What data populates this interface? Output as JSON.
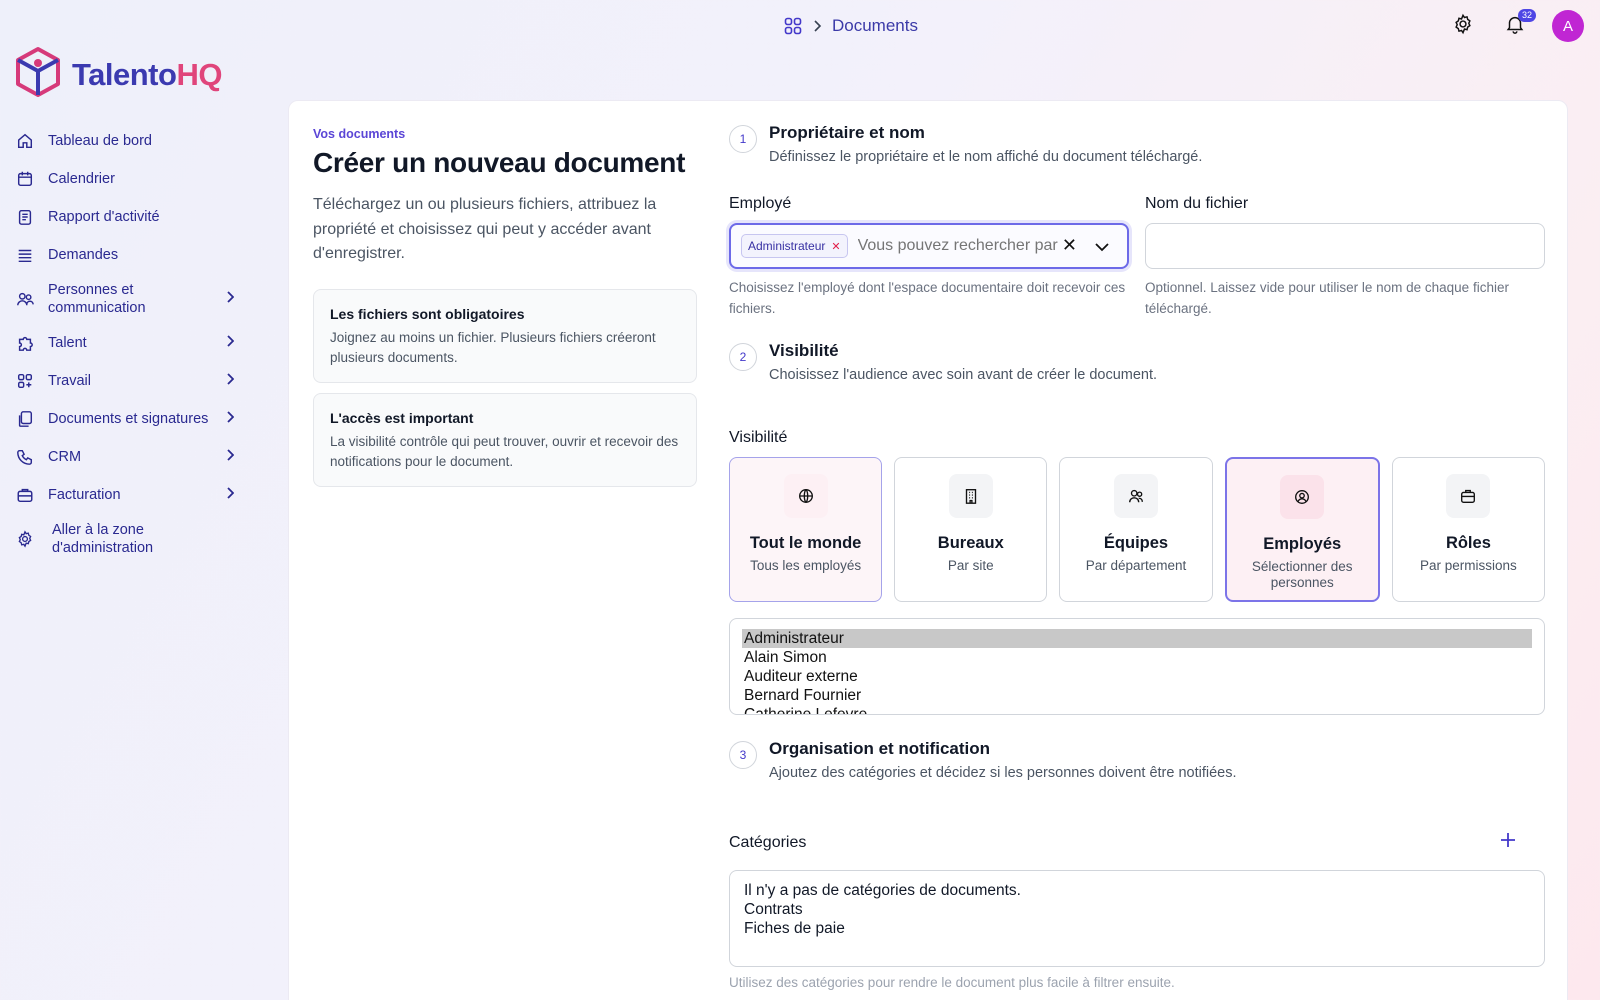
{
  "breadcrumb": {
    "current": "Documents"
  },
  "header": {
    "notification_count": "32",
    "avatar_initial": "A"
  },
  "brand": {
    "part1": "Talento",
    "part2": "HQ"
  },
  "sidebar": {
    "items": [
      {
        "label": "Tableau de bord",
        "icon": "home-icon",
        "has_children": false
      },
      {
        "label": "Calendrier",
        "icon": "calendar-icon",
        "has_children": false
      },
      {
        "label": "Rapport d'activité",
        "icon": "report-icon",
        "has_children": false
      },
      {
        "label": "Demandes",
        "icon": "list-icon",
        "has_children": false
      },
      {
        "label": "Personnes et communication",
        "icon": "people-icon",
        "has_children": true
      },
      {
        "label": "Talent",
        "icon": "puzzle-icon",
        "has_children": true
      },
      {
        "label": "Travail",
        "icon": "grid-icon",
        "has_children": true
      },
      {
        "label": "Documents et signatures",
        "icon": "documents-icon",
        "has_children": true
      },
      {
        "label": "CRM",
        "icon": "phone-icon",
        "has_children": true
      },
      {
        "label": "Facturation",
        "icon": "briefcase-icon",
        "has_children": true
      },
      {
        "label": "Aller à la zone d'administration",
        "icon": "gear-icon",
        "has_children": false
      }
    ]
  },
  "intro": {
    "eyebrow": "Vos documents",
    "title": "Créer un nouveau document",
    "lead": "Téléchargez un ou plusieurs fichiers, attribuez la propriété et choisissez qui peut y accéder avant d'enregistrer.",
    "notes": [
      {
        "title": "Les fichiers sont obligatoires",
        "text": "Joignez au moins un fichier. Plusieurs fichiers créeront plusieurs documents."
      },
      {
        "title": "L'accès est important",
        "text": "La visibilité contrôle qui peut trouver, ouvrir et recevoir des notifications pour le document."
      }
    ]
  },
  "step1": {
    "num": "1",
    "title": "Propriétaire et nom",
    "desc": "Définissez le propriétaire et le nom affiché du document téléchargé.",
    "employee_label": "Employé",
    "employee_chip": "Administrateur",
    "employee_placeholder": "Vous pouvez rechercher par nom, e-mail",
    "employee_help": "Choisissez l'employé dont l'espace documentaire doit recevoir ces fichiers.",
    "filename_label": "Nom du fichier",
    "filename_value": "",
    "filename_help": "Optionnel. Laissez vide pour utiliser le nom de chaque fichier téléchargé."
  },
  "step2": {
    "num": "2",
    "title": "Visibilité",
    "desc": "Choisissez l'audience avec soin avant de créer le document.",
    "label": "Visibilité",
    "options": [
      {
        "title": "Tout le monde",
        "sub": "Tous les employés",
        "icon": "globe-icon"
      },
      {
        "title": "Bureaux",
        "sub": "Par site",
        "icon": "building-icon"
      },
      {
        "title": "Équipes",
        "sub": "Par département",
        "icon": "team-icon"
      },
      {
        "title": "Employés",
        "sub": "Sélectionner des personnes",
        "icon": "user-circle-icon"
      },
      {
        "title": "Rôles",
        "sub": "Par permissions",
        "icon": "briefcase-icon"
      }
    ],
    "employees": [
      "Administrateur",
      "Alain Simon",
      "Auditeur externe",
      "Bernard Fournier",
      "Catherine Lefevre"
    ]
  },
  "step3": {
    "num": "3",
    "title": "Organisation et notification",
    "desc": "Ajoutez des catégories et décidez si les personnes doivent être notifiées.",
    "categories_label": "Catégories",
    "categories": [
      "Il n'y a pas de catégories de documents.",
      "Contrats",
      "Fiches de paie"
    ],
    "categories_help": "Utilisez des catégories pour rendre le document plus facile à filtrer ensuite."
  },
  "colors": {
    "accent": "#4f46e5",
    "nav_text": "#2a2990",
    "brand_pink": "#e0457b",
    "avatar": "#c026d3"
  }
}
